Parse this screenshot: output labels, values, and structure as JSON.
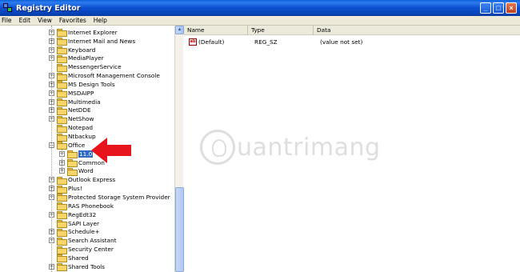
{
  "window": {
    "title": "Registry Editor"
  },
  "menu": [
    "File",
    "Edit",
    "View",
    "Favorites",
    "Help"
  ],
  "tree": [
    {
      "label": "Internet Explorer",
      "expander": "+",
      "level": 0
    },
    {
      "label": "Internet Mail and News",
      "expander": "+",
      "level": 0
    },
    {
      "label": "Keyboard",
      "expander": "+",
      "level": 0
    },
    {
      "label": "MediaPlayer",
      "expander": "+",
      "level": 0
    },
    {
      "label": "MessengerService",
      "expander": "",
      "level": 0
    },
    {
      "label": "Microsoft Management Console",
      "expander": "+",
      "level": 0
    },
    {
      "label": "MS Design Tools",
      "expander": "+",
      "level": 0
    },
    {
      "label": "MSDAIPP",
      "expander": "+",
      "level": 0
    },
    {
      "label": "Multimedia",
      "expander": "+",
      "level": 0
    },
    {
      "label": "NetDDE",
      "expander": "+",
      "level": 0
    },
    {
      "label": "NetShow",
      "expander": "+",
      "level": 0
    },
    {
      "label": "Notepad",
      "expander": "",
      "level": 0
    },
    {
      "label": "Ntbackup",
      "expander": "",
      "level": 0
    },
    {
      "label": "Office",
      "expander": "-",
      "level": 0
    },
    {
      "label": "11.0",
      "expander": "+",
      "level": 1,
      "selected": true
    },
    {
      "label": "Common",
      "expander": "+",
      "level": 1
    },
    {
      "label": "Word",
      "expander": "+",
      "level": 1
    },
    {
      "label": "Outlook Express",
      "expander": "+",
      "level": 0
    },
    {
      "label": "Plus!",
      "expander": "+",
      "level": 0
    },
    {
      "label": "Protected Storage System Provider",
      "expander": "+",
      "level": 0
    },
    {
      "label": "RAS Phonebook",
      "expander": "",
      "level": 0
    },
    {
      "label": "RegEdt32",
      "expander": "+",
      "level": 0
    },
    {
      "label": "SAPI Layer",
      "expander": "",
      "level": 0
    },
    {
      "label": "Schedule+",
      "expander": "+",
      "level": 0
    },
    {
      "label": "Search Assistant",
      "expander": "+",
      "level": 0
    },
    {
      "label": "Security Center",
      "expander": "",
      "level": 0
    },
    {
      "label": "Shared",
      "expander": "",
      "level": 0
    },
    {
      "label": "Shared Tools",
      "expander": "+",
      "level": 0
    }
  ],
  "list": {
    "columns": [
      "Name",
      "Type",
      "Data"
    ],
    "rows": [
      {
        "name": "(Default)",
        "type": "REG_SZ",
        "data": "(value not set)",
        "icon": "ab-string-icon"
      }
    ]
  },
  "watermark": {
    "text": "uantrimang"
  },
  "colors": {
    "selection": "#316ac5",
    "arrow": "#e8141c",
    "titlebar": "#0b4fd0"
  }
}
